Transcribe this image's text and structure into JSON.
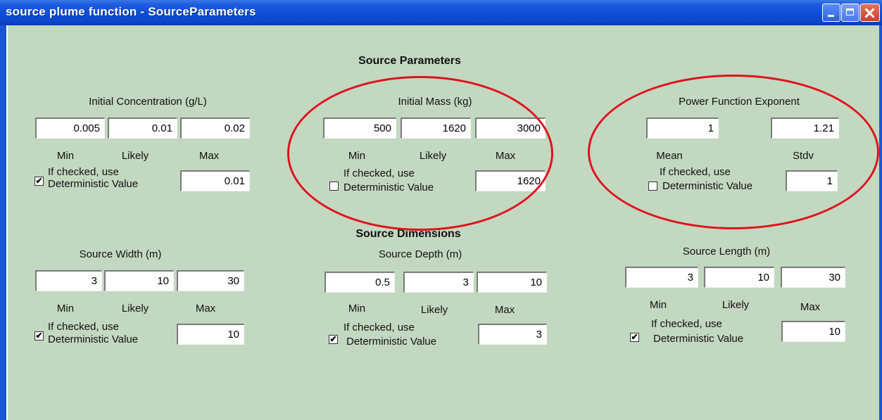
{
  "window": {
    "title": "source plume  function - SourceParameters"
  },
  "headings": {
    "source_parameters": "Source Parameters",
    "source_dimensions": "Source Dimensions"
  },
  "labels": {
    "min": "Min",
    "likely": "Likely",
    "max": "Max",
    "mean": "Mean",
    "stdv": "Stdv",
    "checkbox_line1": "If checked, use",
    "checkbox_line2": "Deterministic Value"
  },
  "initial_concentration": {
    "title": "Initial Concentration (g/L)",
    "min": "0.005",
    "likely": "0.01",
    "max": "0.02",
    "use_deterministic": true,
    "deterministic": "0.01"
  },
  "initial_mass": {
    "title": "Initial Mass (kg)",
    "min": "500",
    "likely": "1620",
    "max": "3000",
    "use_deterministic": false,
    "deterministic": "1620"
  },
  "power_function_exponent": {
    "title": "Power Function Exponent",
    "mean": "1",
    "stdv": "1.21",
    "use_deterministic": false,
    "deterministic": "1"
  },
  "source_width": {
    "title": "Source Width (m)",
    "min": "3",
    "likely": "10",
    "max": "30",
    "use_deterministic": true,
    "deterministic": "10"
  },
  "source_depth": {
    "title": "Source Depth (m)",
    "min": "0.5",
    "likely": "3",
    "max": "10",
    "use_deterministic": true,
    "deterministic": "3"
  },
  "source_length": {
    "title": "Source Length (m)",
    "min": "3",
    "likely": "10",
    "max": "30",
    "use_deterministic": true,
    "deterministic": "10"
  },
  "colors": {
    "background": "#c3d8c0",
    "titlebar": "#0f4fd8",
    "highlight_ring": "#e0121d"
  }
}
